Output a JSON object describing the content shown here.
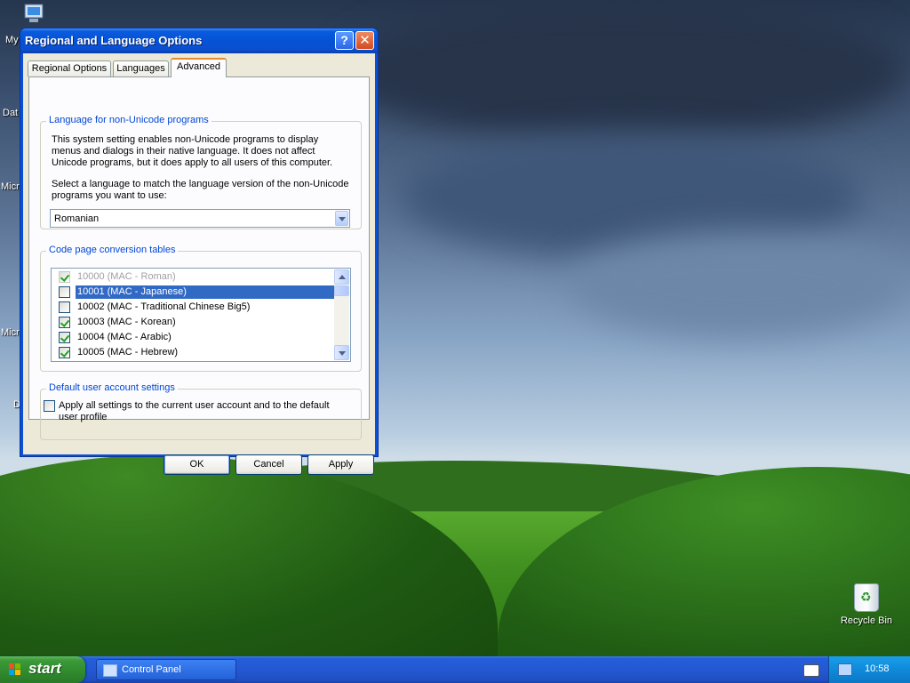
{
  "desktop": {
    "icons": [
      "My",
      "Dat",
      "Micro",
      "Micro",
      "D"
    ],
    "recycle_bin": "Recycle Bin"
  },
  "window": {
    "title": "Regional and Language Options",
    "tabs": [
      "Regional Options",
      "Languages",
      "Advanced"
    ],
    "active_tab": "Advanced",
    "group_non_unicode": {
      "label": "Language for non-Unicode programs",
      "description": "This system setting enables non-Unicode programs to display menus and dialogs in their native language. It does not affect Unicode programs, but it does apply to all users of this computer.",
      "prompt": "Select a language to match the language version of the non-Unicode programs you want to use:",
      "selected_language": "Romanian"
    },
    "group_code_pages": {
      "label": "Code page conversion tables",
      "items": [
        {
          "label": "10000 (MAC - Roman)",
          "checked": true,
          "grayed": true,
          "selected": false
        },
        {
          "label": "10001 (MAC - Japanese)",
          "checked": false,
          "grayed": false,
          "selected": true
        },
        {
          "label": "10002 (MAC - Traditional Chinese Big5)",
          "checked": false,
          "grayed": false,
          "selected": false
        },
        {
          "label": "10003 (MAC - Korean)",
          "checked": true,
          "grayed": false,
          "selected": false
        },
        {
          "label": "10004 (MAC - Arabic)",
          "checked": true,
          "grayed": false,
          "selected": false
        },
        {
          "label": "10005 (MAC - Hebrew)",
          "checked": true,
          "grayed": false,
          "selected": false
        }
      ]
    },
    "group_default_user": {
      "label": "Default user account settings",
      "checkbox_label": "Apply all settings to the current user account and to the default user profile"
    },
    "buttons": {
      "ok": "OK",
      "cancel": "Cancel",
      "apply": "Apply"
    },
    "help_glyph": "?",
    "close_glyph": "✕"
  },
  "taskbar": {
    "start_label": "start",
    "tasks": [
      "Control Panel"
    ],
    "clock": "10:58"
  },
  "colors": {
    "title_bar": "#0552d6",
    "group_label": "#0046d5",
    "selection": "#316ac5",
    "taskbar": "#2458d2",
    "start_button": "#2f8a2d"
  }
}
